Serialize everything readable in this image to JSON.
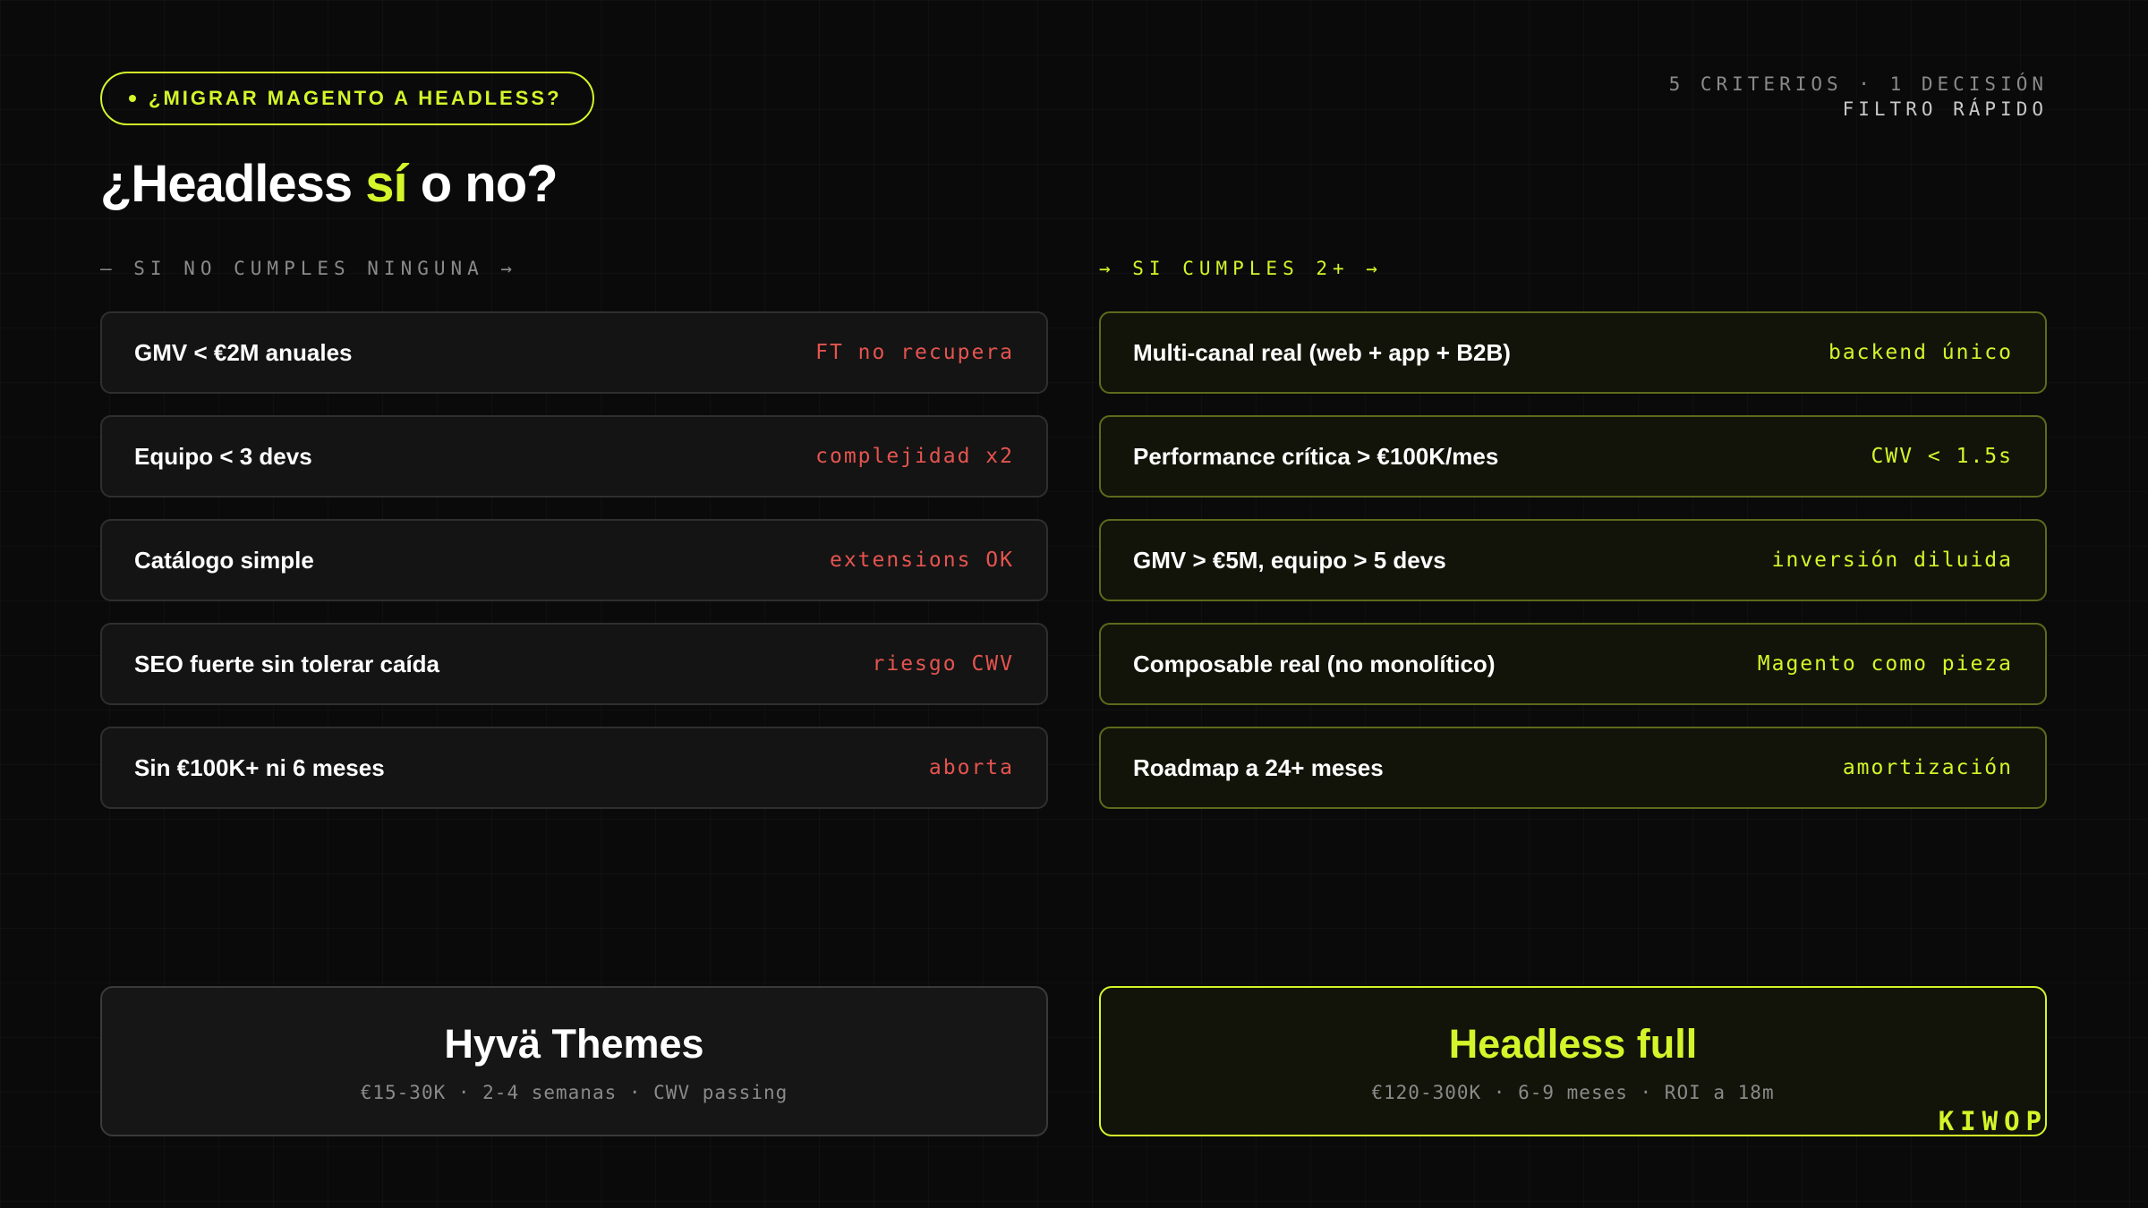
{
  "badge": {
    "label": "¿MIGRAR MAGENTO A HEADLESS?"
  },
  "meta": {
    "line1": "5 CRITERIOS · 1 DECISIÓN",
    "line2": "FILTRO RÁPIDO"
  },
  "title": {
    "before": "¿Headless ",
    "accent": "sí",
    "after": " o no?"
  },
  "left": {
    "label": "— SI NO CUMPLES NINGUNA →",
    "rows": [
      {
        "text": "GMV < €2M anuales",
        "tag": "FT no recupera"
      },
      {
        "text": "Equipo < 3 devs",
        "tag": "complejidad x2"
      },
      {
        "text": "Catálogo simple",
        "tag": "extensions OK"
      },
      {
        "text": "SEO fuerte sin tolerar caída",
        "tag": "riesgo CWV"
      },
      {
        "text": "Sin €100K+ ni 6 meses",
        "tag": "aborta"
      }
    ],
    "result": {
      "title": "Hyvä Themes",
      "subtitle": "€15-30K · 2-4 semanas · CWV passing"
    }
  },
  "right": {
    "label": "→ SI CUMPLES 2+ →",
    "rows": [
      {
        "text": "Multi-canal real (web + app + B2B)",
        "tag": "backend único"
      },
      {
        "text": "Performance crítica > €100K/mes",
        "tag": "CWV < 1.5s"
      },
      {
        "text": "GMV > €5M, equipo > 5 devs",
        "tag": "inversión diluida"
      },
      {
        "text": "Composable real (no monolítico)",
        "tag": "Magento como pieza"
      },
      {
        "text": "Roadmap a 24+ meses",
        "tag": "amortización"
      }
    ],
    "result": {
      "title": "Headless full",
      "subtitle": "€120-300K · 6-9 meses · ROI a 18m"
    }
  },
  "brand": "KIWOP",
  "colors": {
    "accent": "#d4f52a",
    "negative": "#e5544f",
    "background": "#0a0a0a"
  }
}
